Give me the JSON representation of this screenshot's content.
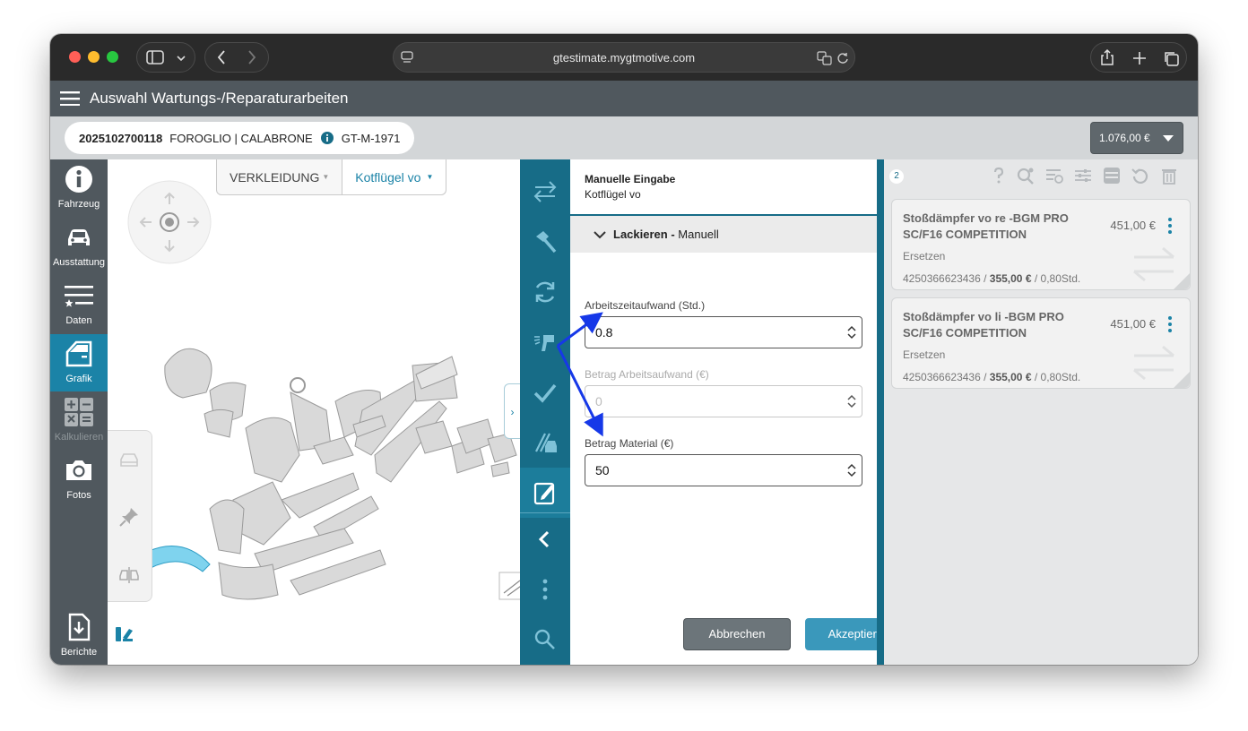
{
  "browser": {
    "url": "gtestimate.mygtmotive.com"
  },
  "header": {
    "title": "Auswahl Wartungs-/Reparaturarbeiten"
  },
  "vehicle": {
    "id": "2025102700118",
    "make_model": "FOROGLIO | CALABRONE",
    "plate": "GT-M-1971",
    "total": "1.076,00 €"
  },
  "sidebar": {
    "items": [
      {
        "label": "Fahrzeug",
        "icon": "info-icon"
      },
      {
        "label": "Ausstattung",
        "icon": "car-icon"
      },
      {
        "label": "Daten",
        "icon": "list-star-icon"
      },
      {
        "label": "Grafik",
        "icon": "car-door-icon",
        "active": true
      },
      {
        "label": "Kalkulieren",
        "icon": "calculator-icon",
        "disabled": true
      },
      {
        "label": "Fotos",
        "icon": "camera-icon"
      },
      {
        "label": "Berichte",
        "icon": "download-file-icon"
      }
    ]
  },
  "graphic": {
    "breadcrumb_group": "VERKLEIDUNG",
    "breadcrumb_part": "Kotflügel vo"
  },
  "manual": {
    "title": "Manuelle Eingabe",
    "subtitle": "Kotflügel vo",
    "section_bold": "Lackieren -",
    "section_mode": "Manuell",
    "fields": [
      {
        "label": "Arbeitszeitaufwand (Std.)",
        "value": "0.8",
        "disabled": false
      },
      {
        "label": "Betrag Arbeitsaufwand (€)",
        "value": "0",
        "disabled": true
      },
      {
        "label": "Betrag Material (€)",
        "value": "50",
        "disabled": false
      }
    ],
    "cancel": "Abbrechen",
    "accept": "Akzeptieren"
  },
  "list": {
    "count": "2",
    "items": [
      {
        "title": "Stoßdämpfer vo re -BGM PRO SC/F16 COMPETITION",
        "price": "451,00 €",
        "action": "Ersetzen",
        "part_no": "4250366623436",
        "part_price": "355,00 €",
        "hours": "0,80Std."
      },
      {
        "title": "Stoßdämpfer vo li -BGM PRO SC/F16 COMPETITION",
        "price": "451,00 €",
        "action": "Ersetzen",
        "part_no": "4250366623436",
        "part_price": "355,00 €",
        "hours": "0,80Std."
      }
    ]
  },
  "colors": {
    "teal": "#176c87",
    "accent": "#1b83a7",
    "annotation_arrow": "#1638e8"
  }
}
